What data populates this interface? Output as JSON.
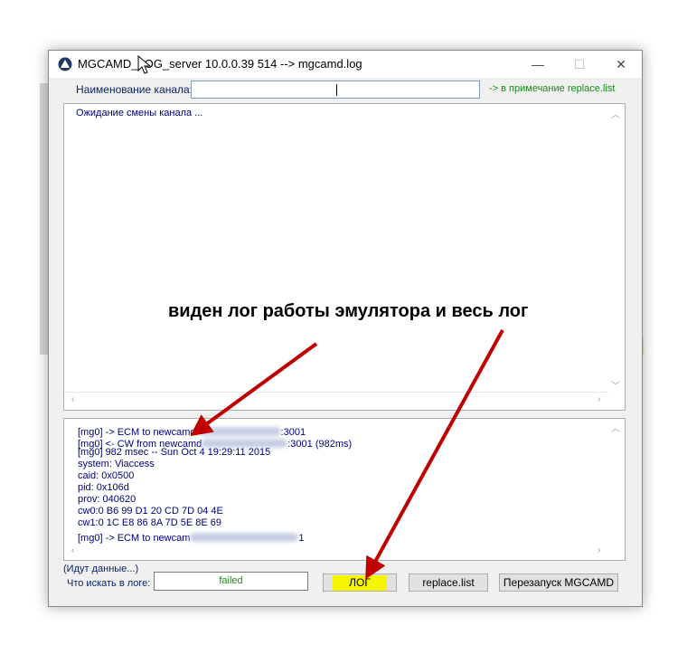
{
  "window": {
    "title": "MGCAMD_LOG_server 10.0.0.39 514  -->  mgcamd.log",
    "controls": {
      "minimize": "—",
      "maximize": "☐",
      "close": "✕"
    }
  },
  "channel": {
    "label": "Наименование канала:",
    "value": "",
    "note_link": "-> в примечание replace.list"
  },
  "top_panel": {
    "lines": [
      "Ожидание смены канала ..."
    ]
  },
  "log_panel": {
    "lines": [
      "[mg0] -> ECM to newcamd",
      "[mg0] <- CW from newcamd",
      "[mg0] 982 msec -- Sun Oct  4 19:29:11 2015",
      "system: Viaccess",
      "caid: 0x0500",
      "pid: 0x106d",
      "prov: 040620",
      "cw0:0 B6 99 D1 20 CD 7D 04 4E",
      "cw1:0 1C E8 86 8A 7D 5E 8E 69",
      "[mg0] -> ECM to newcam"
    ],
    "suffixes": {
      "line0": ":3001",
      "line1": ":3001 (982ms)",
      "line9": "1"
    }
  },
  "status": {
    "data_incoming": "(Идут данные...)",
    "search_label": "Что искать в логе:",
    "search_value": "failed"
  },
  "buttons": {
    "log": "ЛОГ",
    "replace": "replace.list",
    "restart": "Перезапуск MGCAMD"
  },
  "annotation": {
    "text": "виден лог работы эмулятора и весь лог"
  },
  "colors": {
    "highlight": "#f5f500",
    "arrow": "#c00000",
    "note_link": "#1a8a1a",
    "log_text": "#00007f"
  }
}
